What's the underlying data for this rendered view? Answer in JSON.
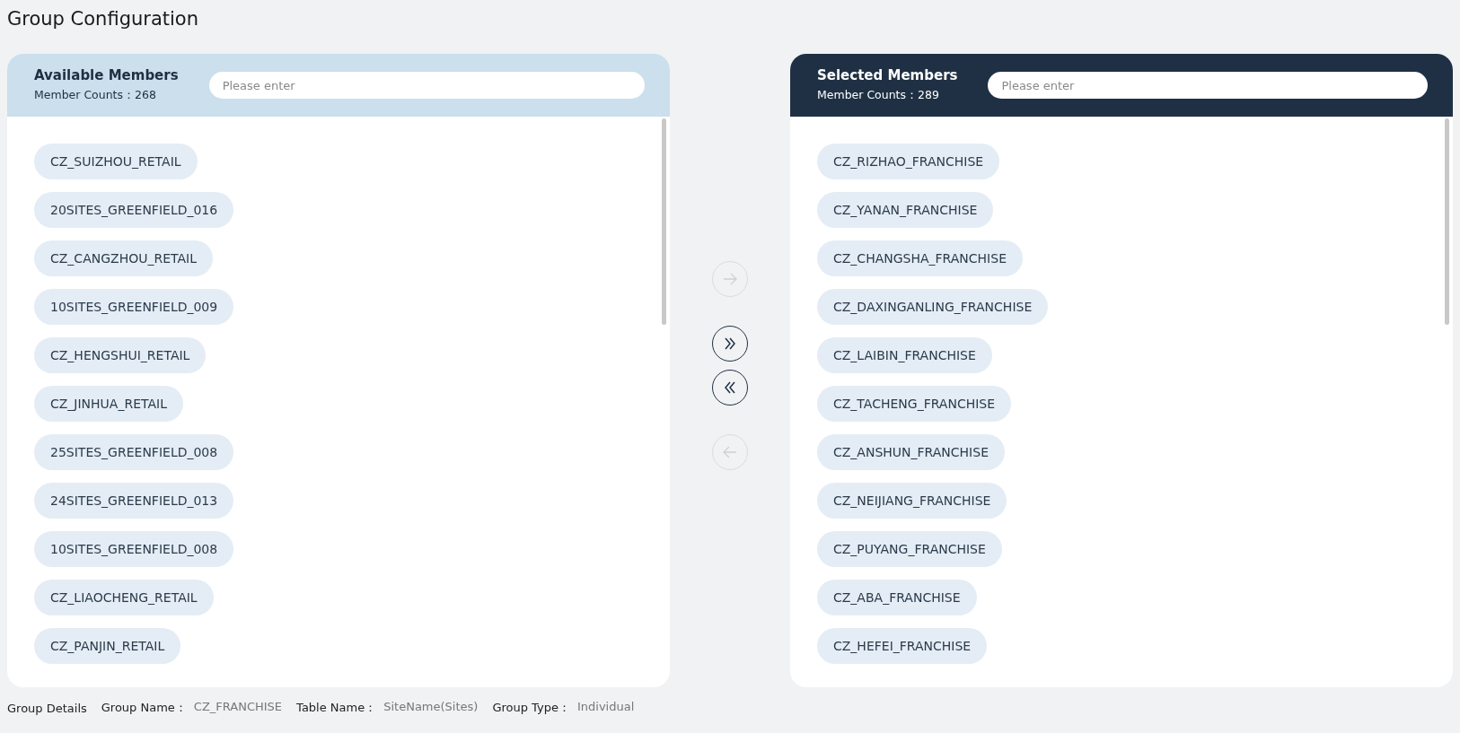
{
  "title": "Group Configuration",
  "panels": [
    {
      "kind": "available",
      "heading": "Available Members",
      "count_label": "Member Counts：",
      "count": "268",
      "search": {
        "placeholder": "Please enter"
      },
      "members": [
        "CZ_SUIZHOU_RETAIL",
        "20SITES_GREENFIELD_016",
        "CZ_CANGZHOU_RETAIL",
        "10SITES_GREENFIELD_009",
        "CZ_HENGSHUI_RETAIL",
        "CZ_JINHUA_RETAIL",
        "25SITES_GREENFIELD_008",
        "24SITES_GREENFIELD_013",
        "10SITES_GREENFIELD_008",
        "CZ_LIAOCHENG_RETAIL",
        "CZ_PANJIN_RETAIL"
      ]
    },
    {
      "kind": "selected",
      "heading": "Selected Members",
      "count_label": "Member Counts：",
      "count": "289",
      "search": {
        "placeholder": "Please enter"
      },
      "members": [
        "CZ_RIZHAO_FRANCHISE",
        "CZ_YANAN_FRANCHISE",
        "CZ_CHANGSHA_FRANCHISE",
        "CZ_DAXINGANLING_FRANCHISE",
        "CZ_LAIBIN_FRANCHISE",
        "CZ_TACHENG_FRANCHISE",
        "CZ_ANSHUN_FRANCHISE",
        "CZ_NEIJIANG_FRANCHISE",
        "CZ_PUYANG_FRANCHISE",
        "CZ_ABA_FRANCHISE",
        "CZ_HEFEI_FRANCHISE"
      ]
    }
  ],
  "transfer_buttons": [
    {
      "kind": "right",
      "disabled": true
    },
    {
      "kind": "all-right",
      "disabled": false
    },
    {
      "kind": "all-left",
      "disabled": false
    },
    {
      "kind": "left",
      "disabled": true
    }
  ],
  "details": {
    "heading": "Group Details",
    "fields": [
      {
        "label": "Group Name：",
        "value": "CZ_FRANCHISE"
      },
      {
        "label": "Table Name：",
        "value": "SiteName(Sites)"
      },
      {
        "label": "Group Type：",
        "value": "Individual"
      }
    ]
  }
}
